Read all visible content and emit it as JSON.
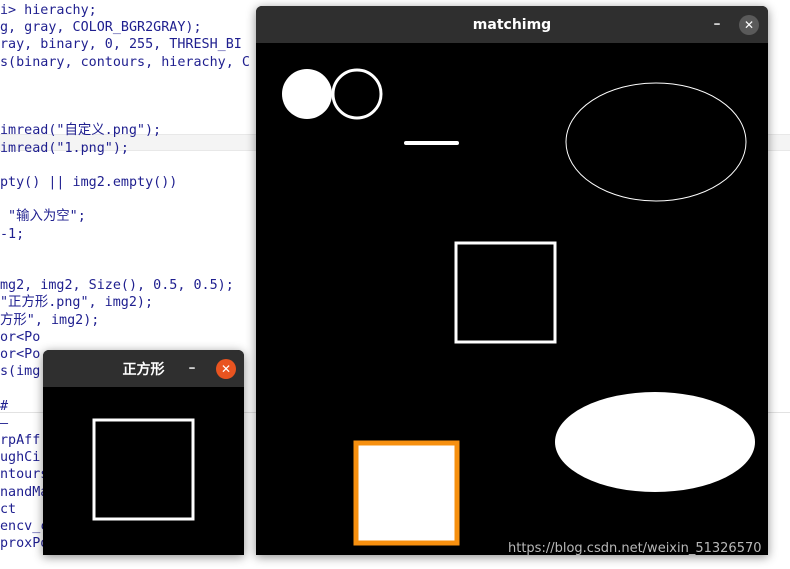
{
  "editor": {
    "lines": [
      "i> hierachy;",
      "g, gray, COLOR_BGR2GRAY);",
      "ray, binary, 0, 255, THRESH_BI",
      "s(binary, contours, hierachy, C",
      "",
      "",
      "",
      "imread(\"自定义.png\");",
      "imread(\"1.png\");",
      "",
      "pty() || img2.empty())",
      "",
      " \"输入为空\";",
      "-1;",
      "",
      "",
      "mg2, img2, Size(), 0.5, 0.5);",
      "\"正方形.png\", img2);",
      "方形\", img2);",
      "or<Po",
      "or<Po",
      "s(img",
      "",
      "#",
      "–",
      "rpAff",
      "ughCi",
      "ntours",
      "nandMa",
      "ct",
      "encv_c",
      "proxPolyDP"
    ]
  },
  "main_window": {
    "title": "matchimg",
    "minimize_label": "–",
    "close_label": "✕",
    "close_color": "#5a5a5a"
  },
  "small_window": {
    "title": "正方形",
    "minimize_label": "–",
    "close_label": "✕",
    "close_color": "#e95420"
  },
  "highlight_color": "#f7900f",
  "watermark": "https://blog.csdn.net/weixin_51326570"
}
